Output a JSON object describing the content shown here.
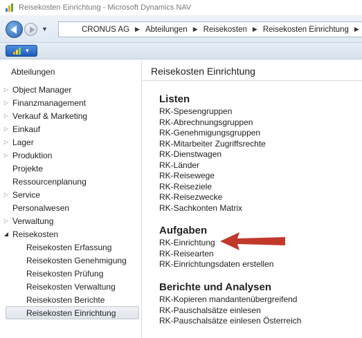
{
  "window": {
    "title": "Reisekosten Einrichtung - Microsoft Dynamics NAV"
  },
  "address": {
    "crumbs": [
      "CRONUS AG",
      "Abteilungen",
      "Reisekosten",
      "Reisekosten Einrichtung"
    ]
  },
  "sidebar": {
    "header": "Abteilungen",
    "items": [
      {
        "label": "Object Manager",
        "expandable": true
      },
      {
        "label": "Finanzmanagement",
        "expandable": true
      },
      {
        "label": "Verkauf & Marketing",
        "expandable": true
      },
      {
        "label": "Einkauf",
        "expandable": true
      },
      {
        "label": "Lager",
        "expandable": true
      },
      {
        "label": "Produktion",
        "expandable": true
      },
      {
        "label": "Projekte",
        "expandable": false
      },
      {
        "label": "Ressourcenplanung",
        "expandable": false
      },
      {
        "label": "Service",
        "expandable": true
      },
      {
        "label": "Personalwesen",
        "expandable": false
      },
      {
        "label": "Verwaltung",
        "expandable": true
      },
      {
        "label": "Reisekosten",
        "expandable": true,
        "expanded": true
      }
    ],
    "subitems": [
      "Reisekosten Erfassung",
      "Reisekosten Genehmigung",
      "Reisekosten Prüfung",
      "Reisekosten Verwaltung",
      "Reisekosten Berichte",
      "Reisekosten Einrichtung"
    ],
    "selected": "Reisekosten Einrichtung"
  },
  "content": {
    "title": "Reisekosten Einrichtung",
    "sections": [
      {
        "title": "Listen",
        "links": [
          "RK-Spesengruppen",
          "RK-Abrechnungsgruppen",
          "RK-Genehmigungsgruppen",
          "RK-Mitarbeiter Zugriffsrechte",
          "RK-Dienstwagen",
          "RK-Länder",
          "RK-Reisewege",
          "RK-Reiseziele",
          "RK-Reisezwecke",
          "RK-Sachkonten Matrix"
        ]
      },
      {
        "title": "Aufgaben",
        "links": [
          "RK-Einrichtung",
          "RK-Reisearten",
          "RK-Einrichtungsdaten erstellen"
        ]
      },
      {
        "title": "Berichte und Analysen",
        "links": [
          "RK-Kopieren mandantenübergreifend",
          "RK-Pauschalsätze einlesen",
          "RK-Pauschalsätze einlesen Österreich"
        ]
      }
    ]
  },
  "colors": {
    "annotation_arrow": "#c0392b",
    "nav_blue": "#2a62b0",
    "selection_bg": "#e4e8ee"
  },
  "icons": {
    "app": "dynamics-nav-logo-icon",
    "back": "back-arrow-icon",
    "forward": "forward-arrow-icon",
    "breadcrumb_separator": "chevron-right-icon",
    "tree_collapsed": "triangle-right-icon",
    "tree_expanded": "triangle-down-icon"
  }
}
